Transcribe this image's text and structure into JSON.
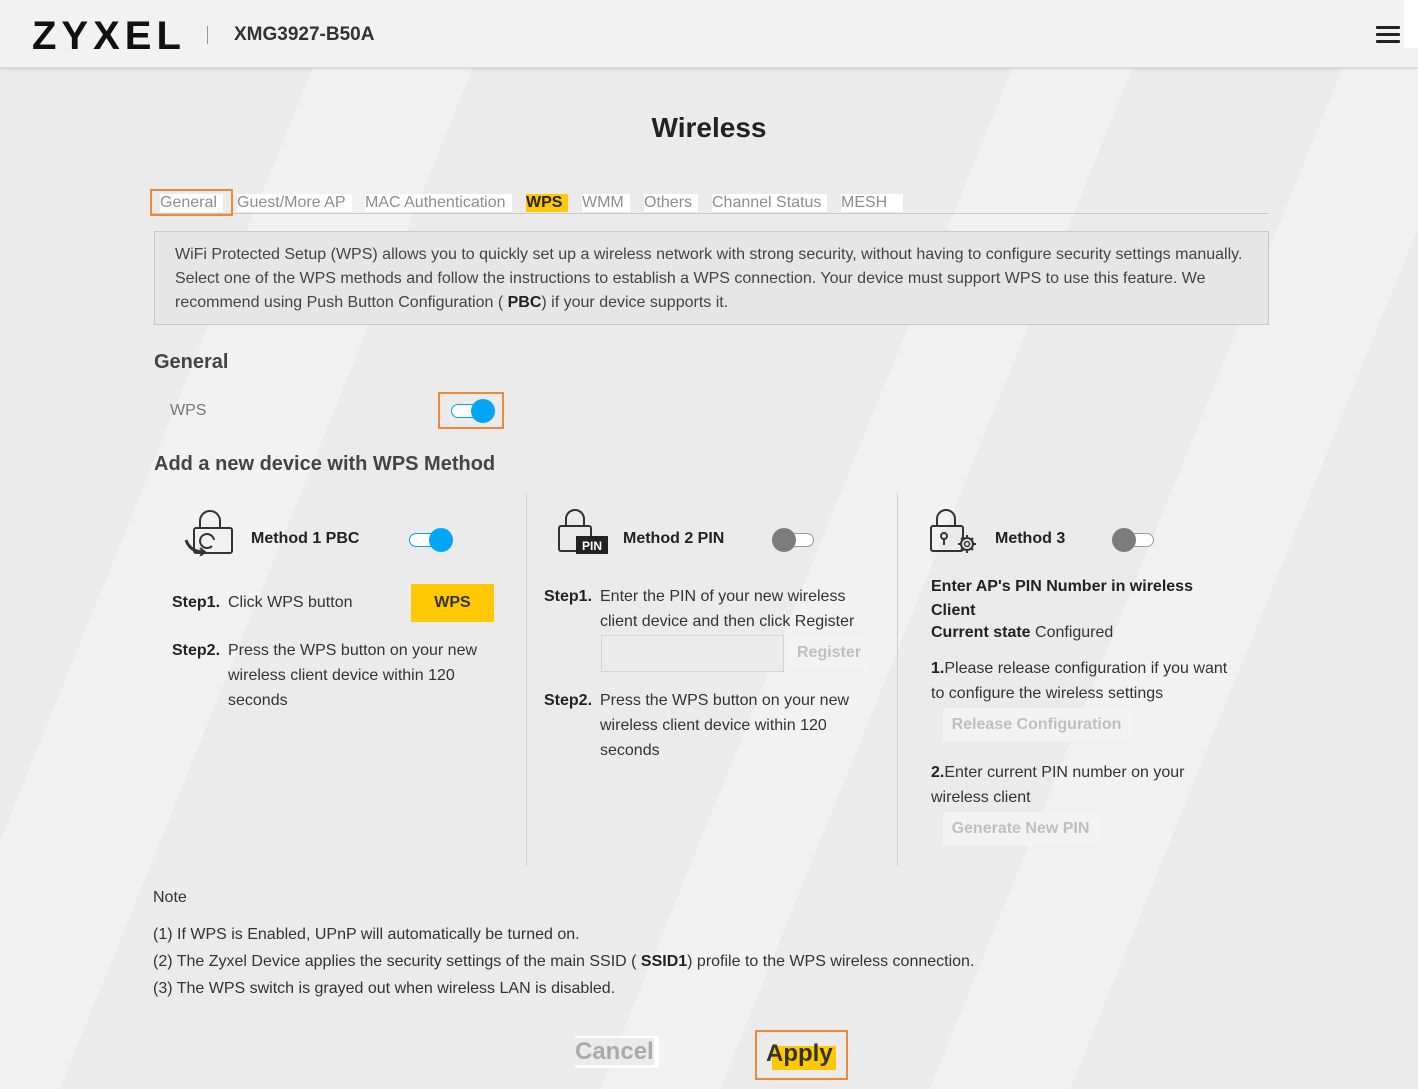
{
  "header": {
    "logo": "ZYXEL",
    "model": "XMG3927-B50A"
  },
  "page": {
    "title": "Wireless"
  },
  "tabs": [
    {
      "label": "General"
    },
    {
      "label": "Guest/More AP"
    },
    {
      "label": "MAC Authentication"
    },
    {
      "label": "WPS"
    },
    {
      "label": "WMM"
    },
    {
      "label": "Others"
    },
    {
      "label": "Channel Status"
    },
    {
      "label": "MESH"
    }
  ],
  "info": {
    "text_before": "WiFi Protected Setup (WPS) allows you to quickly set up a wireless network with strong security, without having to configure security settings manually. Select one of the WPS methods and follow the instructions to establish a WPS connection. Your device must support WPS to use this feature. We recommend using Push Button Configuration ( ",
    "text_bold": "PBC",
    "text_after": ") if your device supports it."
  },
  "general": {
    "title": "General",
    "wps_label": "WPS",
    "wps_enabled": true
  },
  "methods_section": {
    "title": "Add a new device with WPS Method"
  },
  "method1": {
    "title": "Method 1 PBC",
    "enabled": true,
    "step1_label": "Step1.",
    "step1_text": "Click WPS button",
    "wps_button": "WPS",
    "step2_label": "Step2.",
    "step2_text": "Press the WPS button on your new wireless client device within 120 seconds"
  },
  "method2": {
    "title": "Method 2 PIN",
    "enabled": false,
    "icon_badge": "PIN",
    "step1_label": "Step1.",
    "step1_text": "Enter the PIN of your new wireless client device and then click Register",
    "pin_value": "",
    "register_button": "Register",
    "step2_label": "Step2.",
    "step2_text": "Press the WPS button on your new wireless client device within 120 seconds"
  },
  "method3": {
    "title": "Method 3",
    "enabled": false,
    "heading": "Enter AP's PIN Number in wireless Client",
    "state_label": "Current state",
    "state_value": "Configured",
    "item1_num": "1.",
    "item1_text": "Please release configuration if you want to configure the wireless settings",
    "release_button": "Release Configuration",
    "item2_num": "2.",
    "item2_text": "Enter current PIN number on your wireless client",
    "generate_button": "Generate New PIN"
  },
  "notes": {
    "title": "Note",
    "line1": "(1) If WPS is Enabled, UPnP will automatically be turned on.",
    "line2_before": "(2) The Zyxel Device applies the security settings of the main SSID ( ",
    "line2_bold": "SSID1",
    "line2_after": ") profile to the WPS wireless connection.",
    "line3": "(3) The WPS switch is grayed out when wireless LAN is disabled."
  },
  "footer": {
    "cancel": "Cancel",
    "apply": "Apply"
  },
  "colors": {
    "accent": "#ffc800",
    "toggle_on": "#00a6f5",
    "highlight": "#f0883a"
  }
}
